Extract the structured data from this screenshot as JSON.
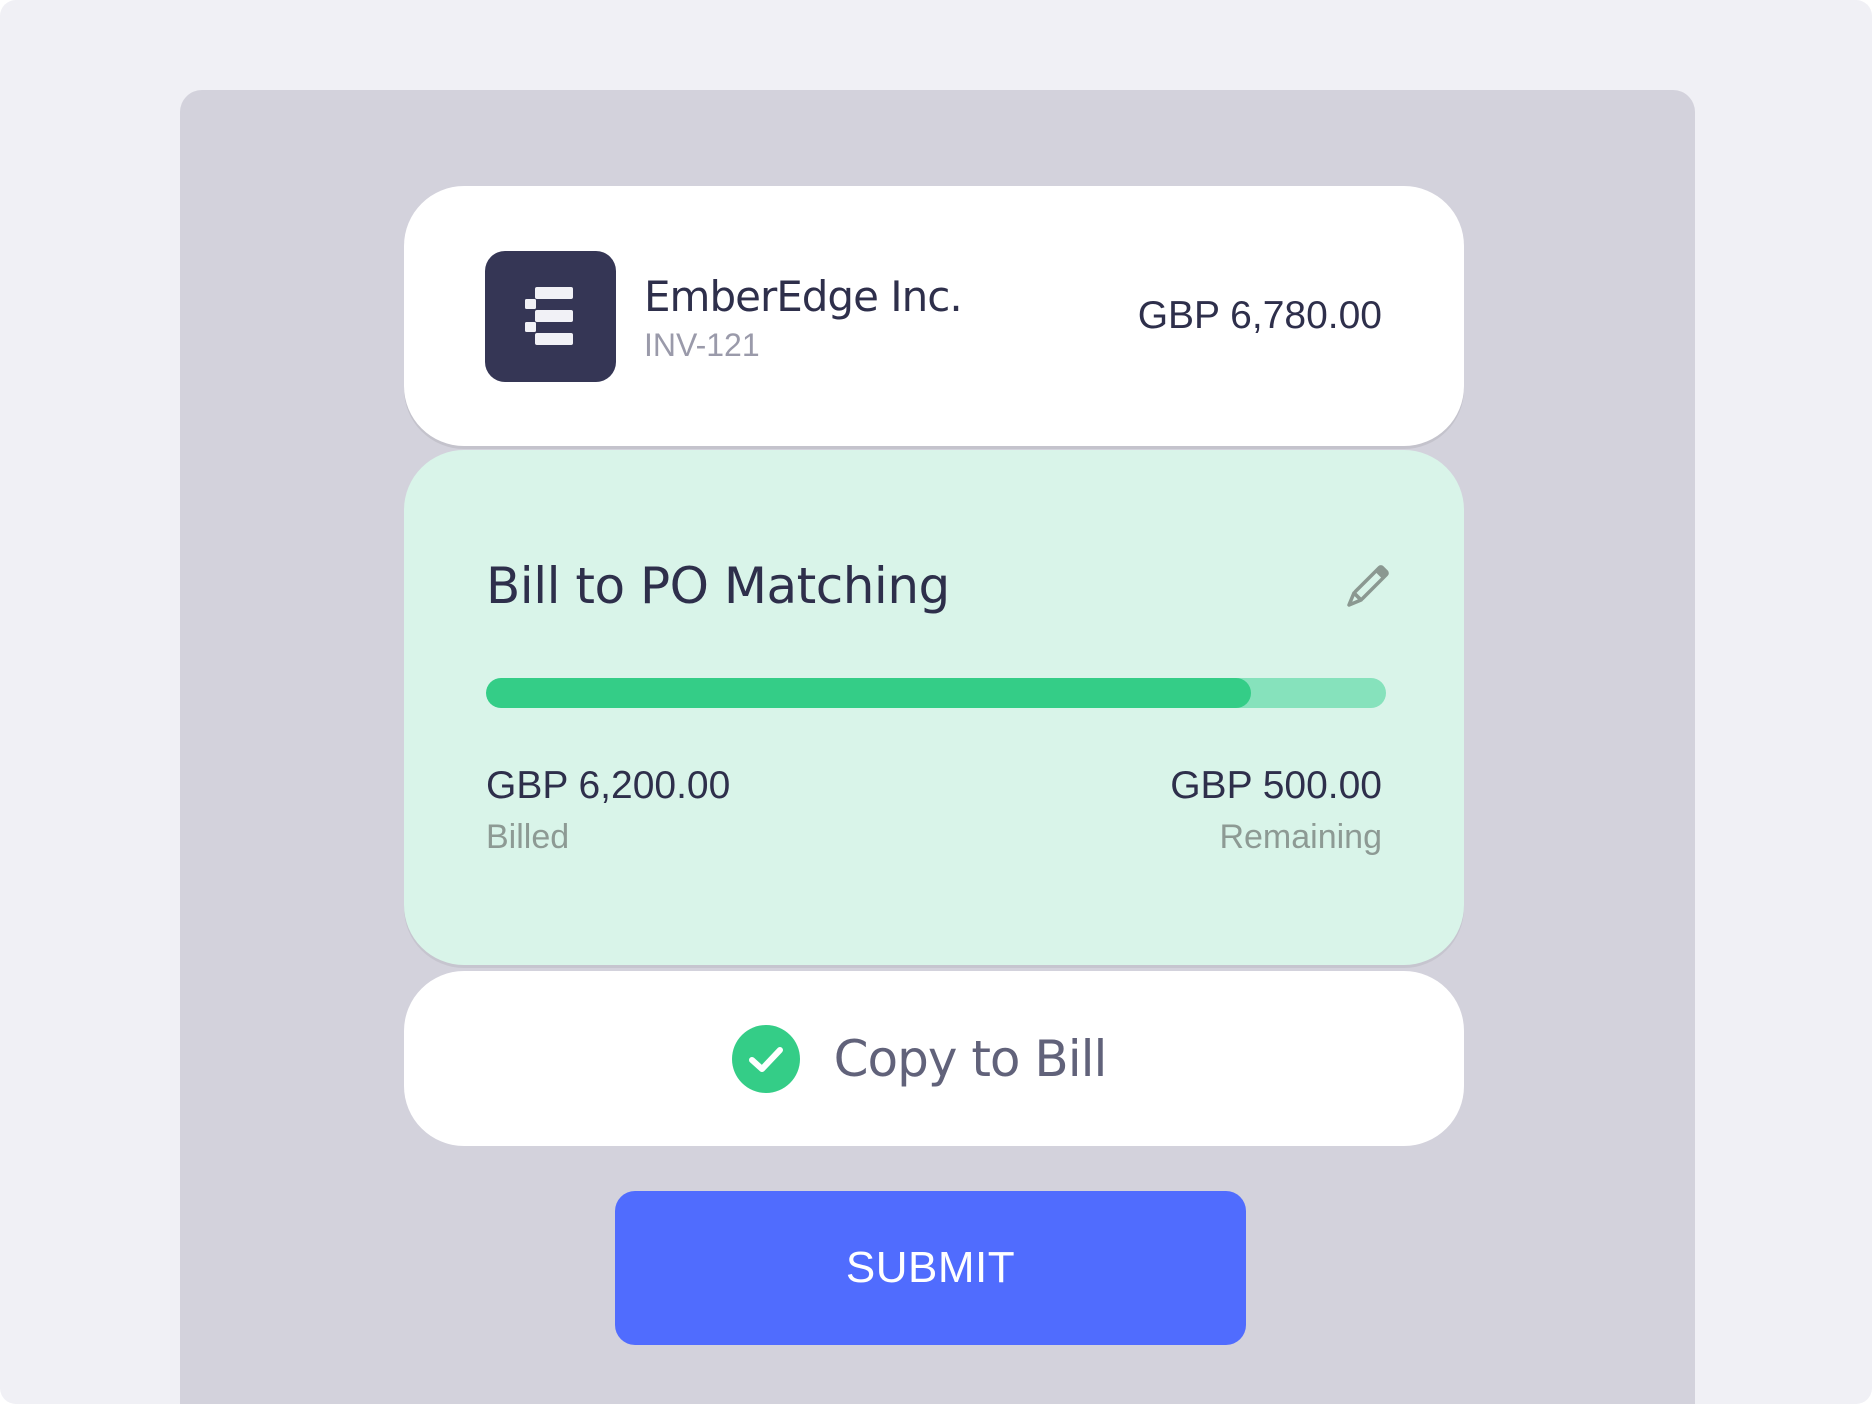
{
  "vendor": {
    "name": "EmberEdge Inc.",
    "invoice_id": "INV-121",
    "amount": "GBP 6,780.00",
    "logo_icon": "list-lines-icon"
  },
  "matching": {
    "title": "Bill to PO Matching",
    "edit_icon": "pencil-icon",
    "progress_percent": 85,
    "billed_amount": "GBP 6,200.00",
    "billed_label": "Billed",
    "remaining_amount": "GBP 500.00",
    "remaining_label": "Remaining"
  },
  "copy": {
    "label": "Copy to Bill",
    "icon": "check-circle-icon",
    "checked": true
  },
  "submit": {
    "label": "SUBMIT"
  },
  "colors": {
    "accent": "#506cfe",
    "success": "#34cd87",
    "success_light": "#86e2bc",
    "match_bg": "#d9f4e9",
    "logo_bg": "#353655",
    "text_dark": "#2e2f4b"
  }
}
